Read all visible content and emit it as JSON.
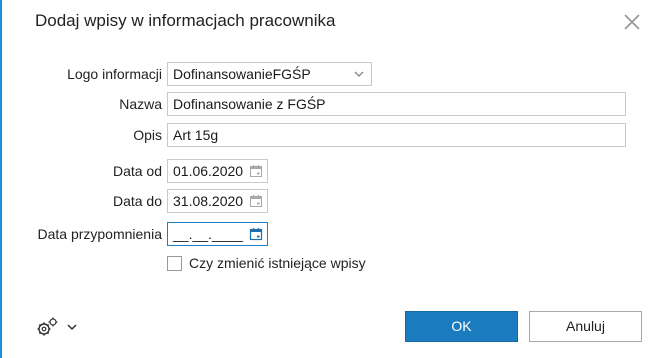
{
  "dialog": {
    "title": "Dodaj wpisy w informacjach pracownika",
    "close_icon": "close-icon"
  },
  "form": {
    "logo": {
      "label": "Logo informacji",
      "value": "DofinansowanieFGŚP"
    },
    "name": {
      "label": "Nazwa",
      "value": "Dofinansowanie z FGŚP"
    },
    "desc": {
      "label": "Opis",
      "value": "Art 15g"
    },
    "date_from": {
      "label": "Data od",
      "value": "01.06.2020"
    },
    "date_to": {
      "label": "Data do",
      "value": "31.08.2020"
    },
    "reminder": {
      "label": "Data przypomnienia",
      "value": "__.__.____"
    },
    "overwrite": {
      "label": "Czy zmienić istniejące wpisy",
      "checked": false
    }
  },
  "footer": {
    "settings_icon": "gears-icon",
    "ok_label": "OK",
    "cancel_label": "Anuluj"
  },
  "colors": {
    "accent": "#1a7bbe",
    "focus_border": "#1d7fc4"
  }
}
